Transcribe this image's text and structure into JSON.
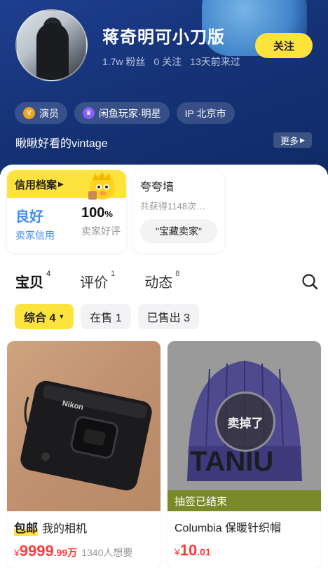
{
  "profile": {
    "username": "蒋奇明可小刀版",
    "followers": "1.7w 粉丝",
    "following": "0 关注",
    "last_seen": "13天前来过",
    "follow_label": "关注",
    "tags": [
      {
        "label": "演员",
        "icon": "v-badge-icon"
      },
      {
        "label": "闲鱼玩家·明星",
        "icon": "crown-icon"
      },
      {
        "label": "IP 北京市",
        "icon": ""
      }
    ],
    "bio": "瞅瞅好看的vintage",
    "more_label": "更多"
  },
  "credit": {
    "title": "信用档案",
    "rating": "良好",
    "rating_label": "卖家信用",
    "positive_rate": "100",
    "positive_unit": "%",
    "positive_label": "卖家好评"
  },
  "praise": {
    "title": "夸夸墙",
    "subtitle": "共获得1148次…",
    "chip": "\"宝藏卖家\""
  },
  "tabs": [
    {
      "label": "宝贝",
      "count": "4"
    },
    {
      "label": "评价",
      "count": "1"
    },
    {
      "label": "动态",
      "count": "8"
    }
  ],
  "filters": [
    {
      "label": "综合 4"
    },
    {
      "label": "在售 1"
    },
    {
      "label": "已售出 3"
    }
  ],
  "items": [
    {
      "badge": "包邮",
      "title": "我的相机",
      "price_symbol": "¥",
      "price_int": "9999",
      "price_dec": ".99万",
      "wants": "1340人想要",
      "image": "nikon-camera"
    },
    {
      "title": "Columbia 保暖针织帽",
      "price_symbol": "¥",
      "price_int": "10",
      "price_dec": ".01",
      "status": "抽签已结束",
      "stamp": "卖掉了",
      "image": "knit-beanie"
    }
  ],
  "colors": {
    "header": "#163377",
    "accent": "#ffe33d",
    "price": "#ff3b3b",
    "credit": "#3f8cf0"
  }
}
